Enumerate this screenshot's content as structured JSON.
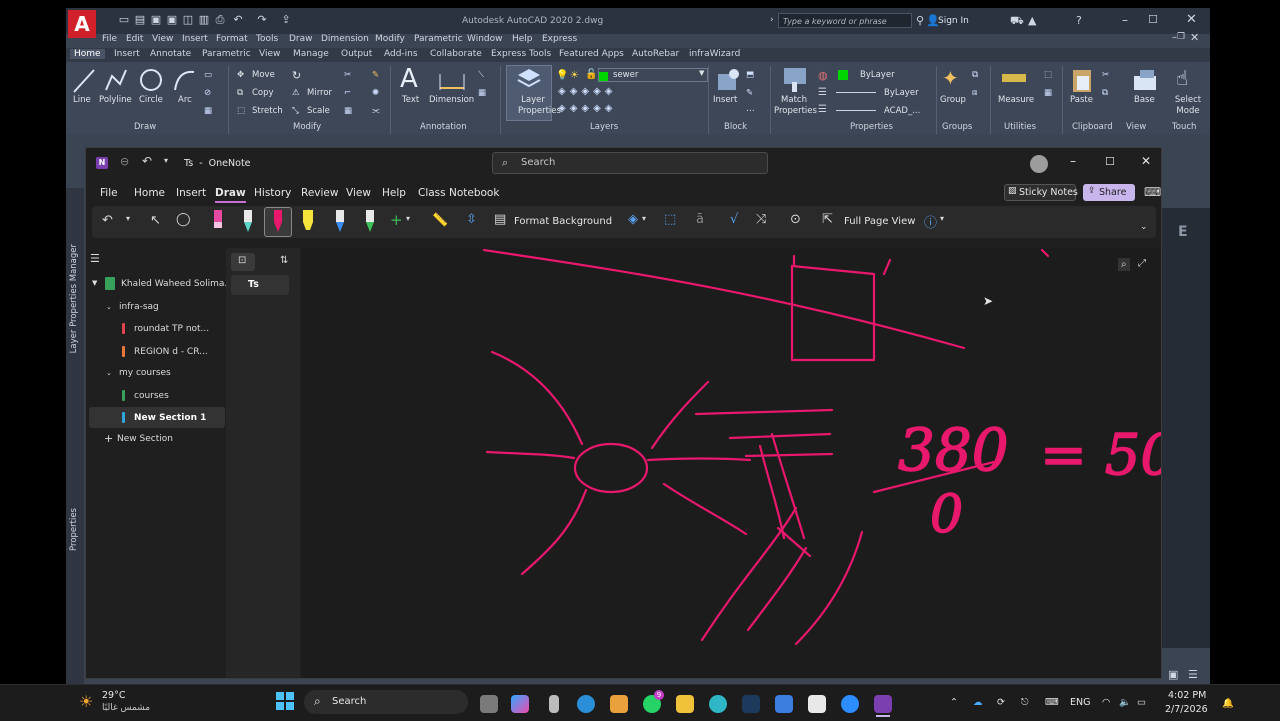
{
  "autocad": {
    "title": "Autodesk AutoCAD 2020    2.dwg",
    "search_placeholder": "Type a keyword or phrase",
    "signin": "Sign In",
    "menu": [
      "File",
      "Edit",
      "View",
      "Insert",
      "Format",
      "Tools",
      "Draw",
      "Dimension",
      "Modify",
      "Parametric",
      "Window",
      "Help",
      "Express"
    ],
    "ribbon_tabs": [
      "Home",
      "Insert",
      "Annotate",
      "Parametric",
      "View",
      "Manage",
      "Output",
      "Add-ins",
      "Collaborate",
      "Express Tools",
      "Featured Apps",
      "AutoRebar",
      "infraWizard"
    ],
    "draw": {
      "line": "Line",
      "polyline": "Polyline",
      "circle": "Circle",
      "arc": "Arc",
      "panel": "Draw"
    },
    "modify": {
      "move": "Move",
      "copy": "Copy",
      "stretch": "Stretch",
      "rotate": "",
      "mirror": "Mirror",
      "scale": "Scale",
      "panel": "Modify"
    },
    "annotation": {
      "text": "Text",
      "dimension": "Dimension",
      "panel": "Annotation"
    },
    "layers": {
      "layer_properties": "Layer Properties",
      "current_layer": "sewer",
      "panel": "Layers"
    },
    "block": {
      "insert": "Insert",
      "panel": "Block"
    },
    "properties": {
      "match": "Match Properties",
      "color": "ByLayer",
      "linetype": "ByLayer",
      "lineweight": "ACAD_...",
      "panel": "Properties"
    },
    "groups": {
      "group": "Group",
      "panel": "Groups"
    },
    "utilities": {
      "measure": "Measure",
      "panel": "Utilities"
    },
    "clipboard": {
      "paste": "Paste",
      "panel": "Clipboard"
    },
    "view": {
      "base": "Base",
      "panel": "View"
    },
    "touch": {
      "select_mode": "Select Mode",
      "panel": "Touch"
    },
    "side_left_top": "Layer Properties Manager",
    "side_left_bottom": "Properties"
  },
  "onenote": {
    "title": "Ts  -  OneNote",
    "search_placeholder": "Search",
    "menu": [
      "File",
      "Home",
      "Insert",
      "Draw",
      "History",
      "Review",
      "View",
      "Help",
      "Class Notebook"
    ],
    "active_menu": "Draw",
    "sticky_notes": "Sticky Notes",
    "share": "Share",
    "format_background": "Format Background",
    "full_page_view": "Full Page View",
    "notebook": "Khaled Waheed Solima...",
    "groups": [
      {
        "name": "infra-sag",
        "sections": [
          {
            "name": "roundat TP not...",
            "color": "#e0444f"
          },
          {
            "name": "REGION d - CR...",
            "color": "#e8763a"
          }
        ]
      },
      {
        "name": "my courses",
        "sections": [
          {
            "name": "courses",
            "color": "#37a05a"
          },
          {
            "name": "New Section 1",
            "color": "#2ea7d8"
          }
        ]
      }
    ],
    "new_section": "New Section",
    "page": "Ts",
    "ink_color": "#e8186d",
    "ink_text_1": "380",
    "ink_text_2": "0",
    "ink_text_3": "= 50"
  },
  "taskbar": {
    "weather_temp": "29°C",
    "weather_desc": "مشمس غالبًا",
    "search": "Search",
    "lang": "ENG",
    "time": "4:02 PM",
    "date": "2/7/2026"
  }
}
